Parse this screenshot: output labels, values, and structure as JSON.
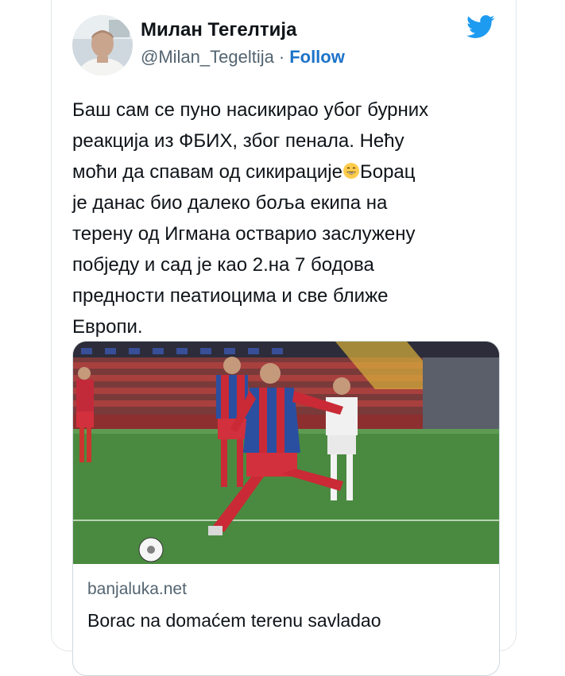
{
  "tweet": {
    "author": {
      "display_name": "Милан Тегелтија",
      "handle": "@Milan_Tegeltija",
      "separator": "·",
      "follow_label": "Follow"
    },
    "logo_icon": "twitter-bird-icon",
    "text_part1": "Баш сам се пуно насикирао убог бурних\nреакција из ФБИХ, због пенала. Нећу\nмоћи да спавам од сикирације",
    "emoji_icon": "grinning-face-emoji",
    "text_part2": "Борац\nје данас био далеко боља екипа на\nтерену од Игмана остварио заслужену\nпобједу и сад је као 2.на 7 бодова\nпредности пеатиоцима и све ближе\nЕвропи.",
    "link_card": {
      "domain": "banjaluka.net",
      "title": "Borac na domaćem terenu savladao"
    },
    "colors": {
      "accent": "#1d9bf0",
      "follow": "#1d73c8",
      "text": "#0f1419",
      "muted": "#536471"
    }
  }
}
